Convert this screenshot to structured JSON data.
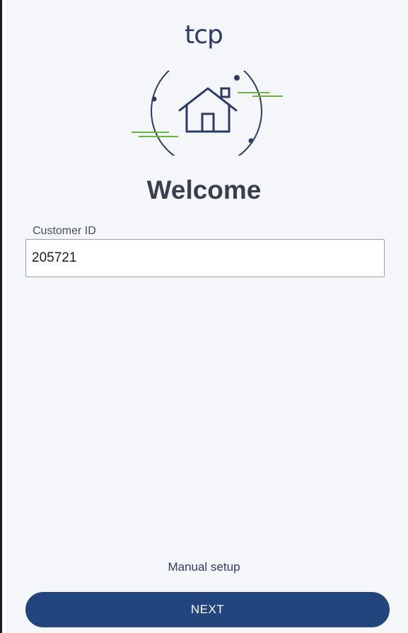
{
  "app": {
    "logo_text": "tcp"
  },
  "welcome": {
    "title": "Welcome"
  },
  "customer_id": {
    "label": "Customer ID",
    "value": "205721"
  },
  "actions": {
    "manual_setup_label": "Manual setup",
    "next_label": "NEXT"
  },
  "colors": {
    "brand_navy": "#2b3a67",
    "button_blue": "#22457e",
    "accent_green": "#6cb33f",
    "background": "#f4f6fa"
  },
  "icons": {
    "hero": "house-in-circle-icon"
  }
}
